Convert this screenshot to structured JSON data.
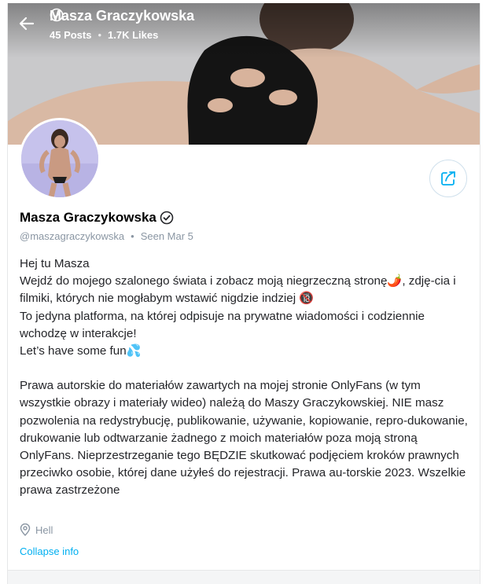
{
  "header": {
    "name": "Masza Graczykowska",
    "posts": "45 Posts",
    "separator": "•",
    "likes": "1.7K Likes",
    "back_icon": "arrow-left-icon",
    "verified_icon": "verified-badge-icon"
  },
  "profile": {
    "name": "Masza Graczykowska",
    "handle": "@maszagraczykowska",
    "separator": "•",
    "seen": "Seen  Mar 5",
    "share_icon": "share-icon"
  },
  "bio": {
    "lines": [
      "Hej tu Masza",
      "Wejdź do mojego szalonego świata i zobacz moją niegrzeczną stronę🌶️, zdję-cia i filmiki, których nie mogłabym wstawić nigdzie indziej 🔞",
      "To jedyna platforma, na której odpisuje na prywatne wiadomości i codziennie wchodzę w interakcje!",
      "Let’s have some fun💦"
    ],
    "copyright": "Prawa autorskie do materiałów zawartych na mojej stronie OnlyFans (w tym wszystkie obrazy i materiały wideo) należą do Maszy Graczykowskiej. NIE masz pozwolenia na redystrybucję, publikowanie, używanie, kopiowanie, repro-dukowanie, drukowanie lub odtwarzanie żadnego z moich materiałów poza moją stroną OnlyFans. Nieprzestrzeganie tego BĘDZIE skutkować podjęciem kroków prawnych przeciwko osobie, której dane użyłeś do rejestracji. Prawa au-torskie 2023. Wszelkie prawa zastrzeżone"
  },
  "location": {
    "text": "Hell",
    "icon": "location-pin-icon"
  },
  "collapse_label": "Collapse info",
  "colors": {
    "accent": "#00aff0",
    "muted": "#8a96a3",
    "text": "#242529"
  }
}
